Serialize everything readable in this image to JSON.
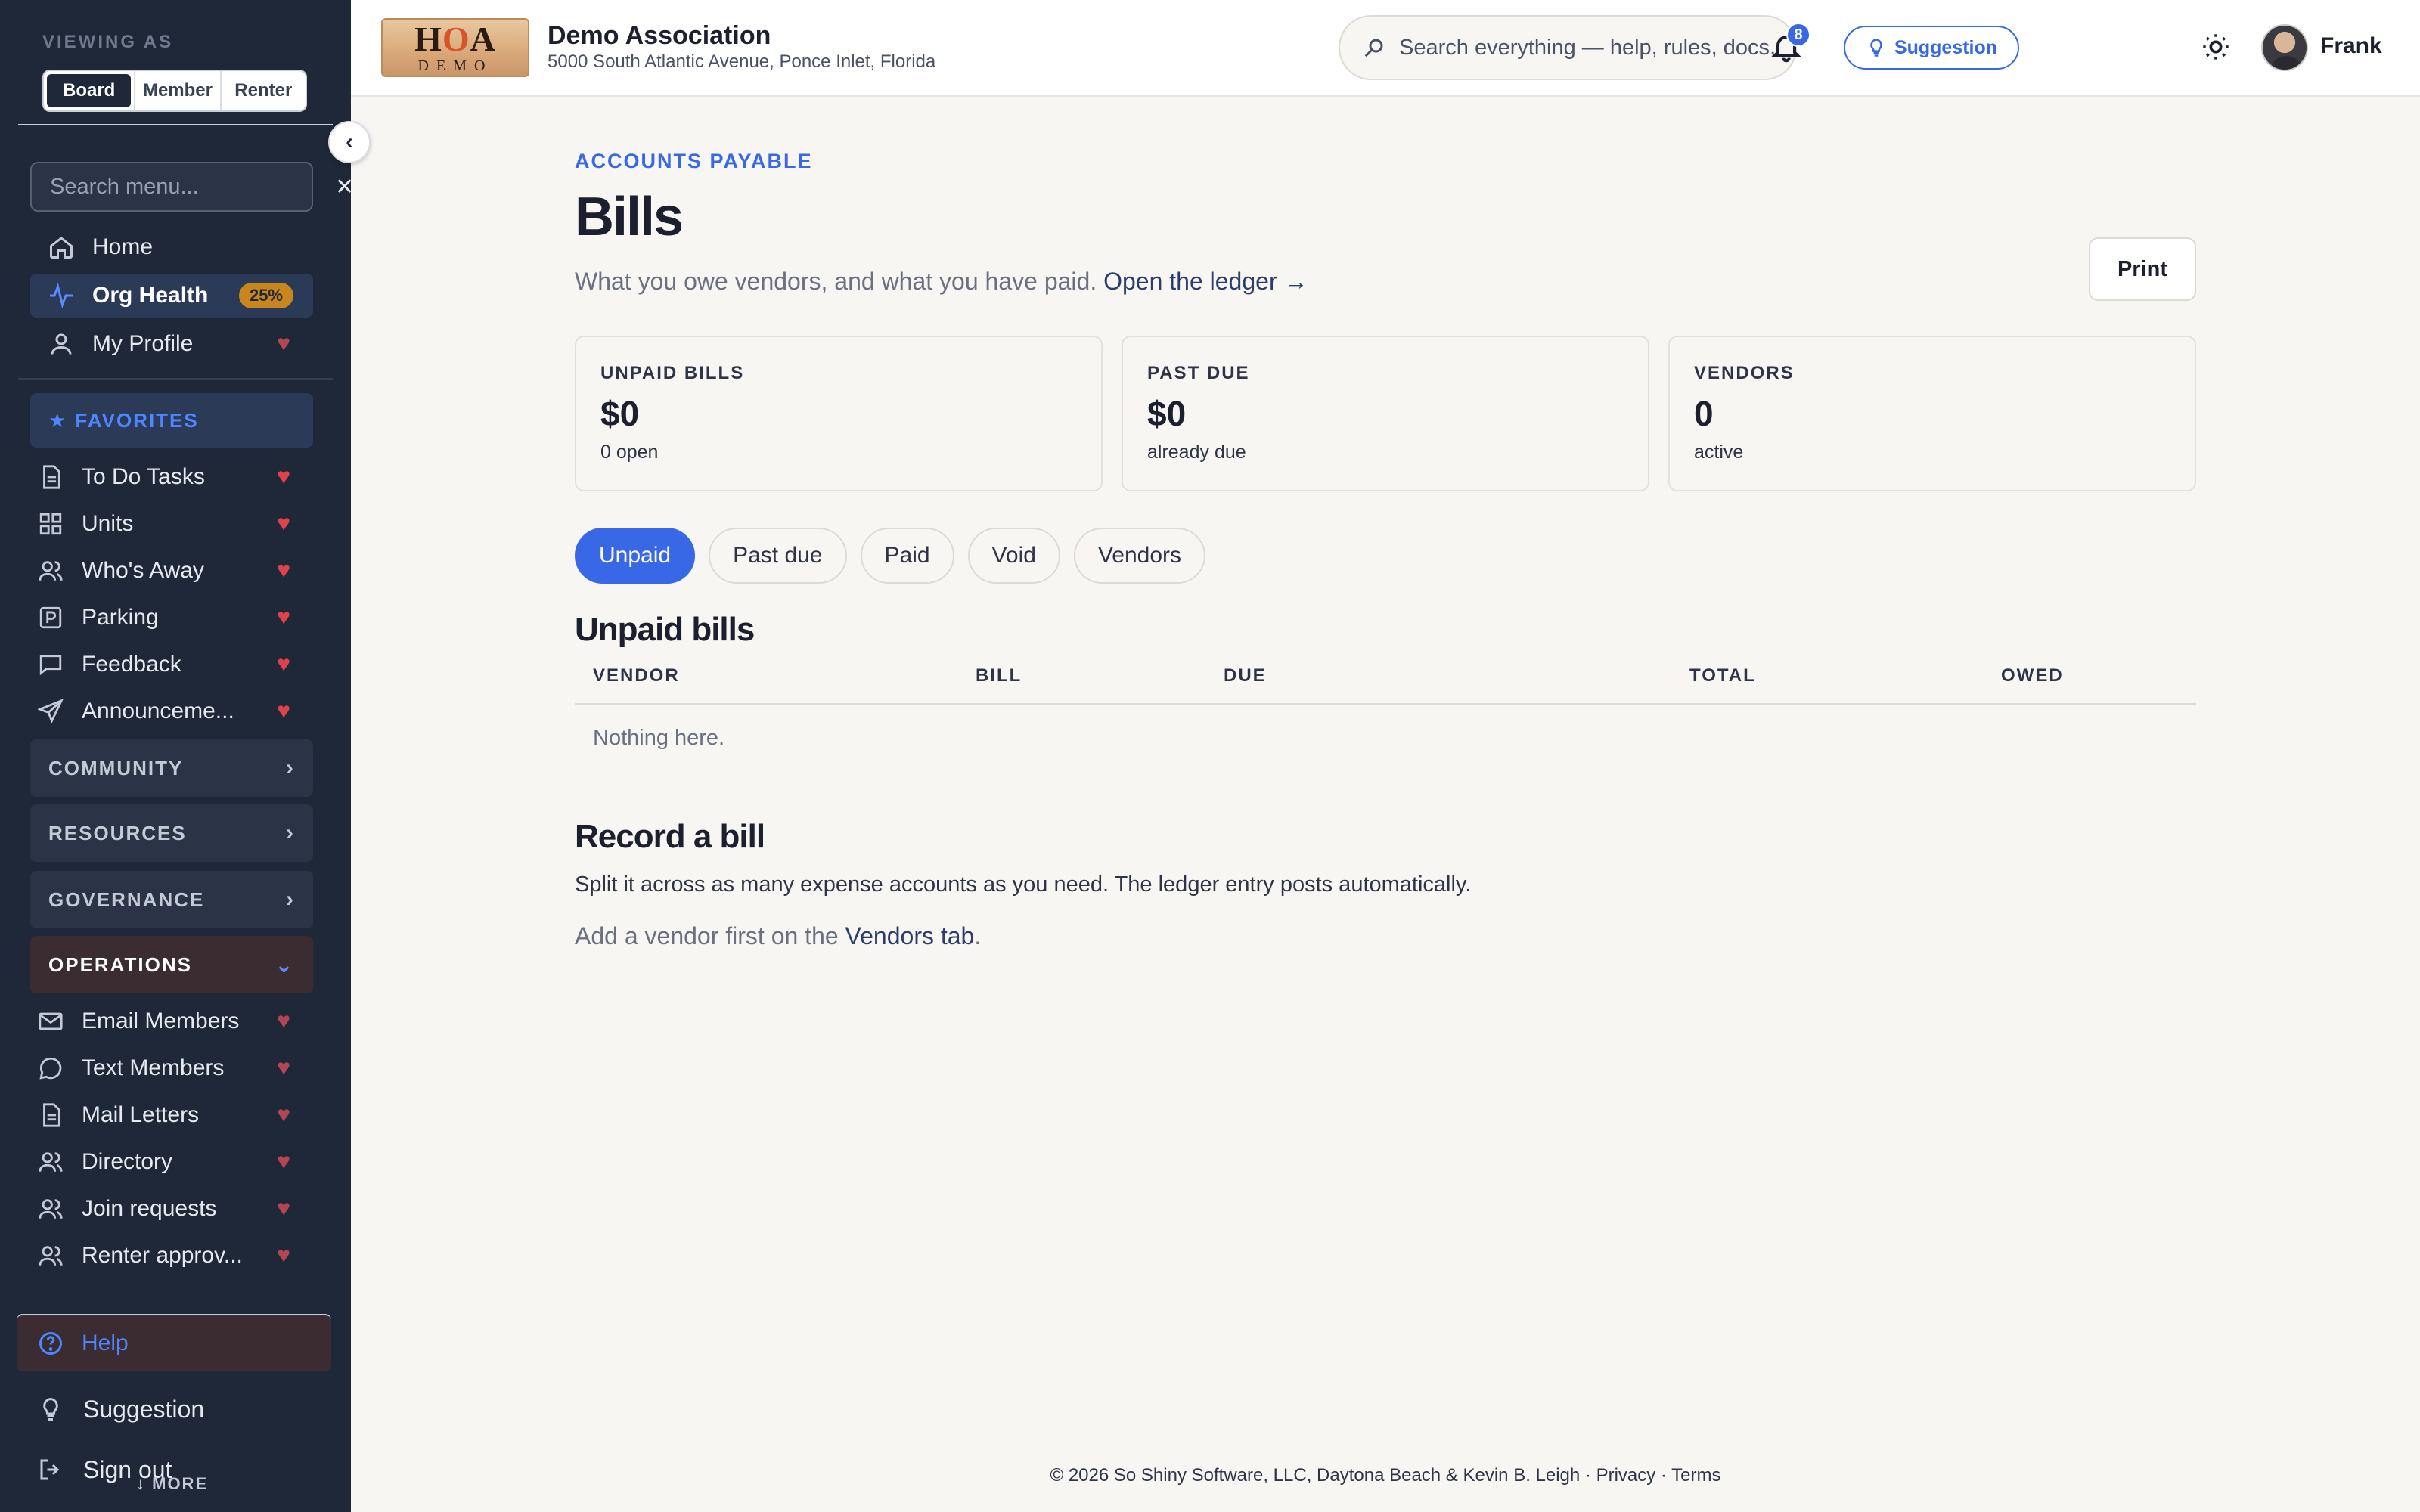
{
  "sidebar": {
    "viewing_as_label": "VIEWING AS",
    "roles": [
      "Board",
      "Member",
      "Renter"
    ],
    "search_placeholder": "Search menu...",
    "main_items": [
      {
        "label": "Home",
        "icon": "home-icon"
      },
      {
        "label": "Org Health",
        "icon": "pulse-icon",
        "badge": "25%",
        "active": true
      },
      {
        "label": "My Profile",
        "icon": "user-icon",
        "heart": true
      }
    ],
    "favorites_label": "FAVORITES",
    "favorites": [
      {
        "label": "To Do Tasks",
        "icon": "document-icon"
      },
      {
        "label": "Units",
        "icon": "grid-icon"
      },
      {
        "label": "Who's Away",
        "icon": "users-icon"
      },
      {
        "label": "Parking",
        "icon": "parking-icon"
      },
      {
        "label": "Feedback",
        "icon": "chat-icon"
      },
      {
        "label": "Announceme...",
        "icon": "send-icon"
      }
    ],
    "sections": [
      {
        "label": "COMMUNITY",
        "open": false
      },
      {
        "label": "RESOURCES",
        "open": false
      },
      {
        "label": "GOVERNANCE",
        "open": false
      },
      {
        "label": "OPERATIONS",
        "open": true
      }
    ],
    "operations_items": [
      {
        "label": "Email Members",
        "icon": "mail-icon"
      },
      {
        "label": "Text Members",
        "icon": "message-icon"
      },
      {
        "label": "Mail Letters",
        "icon": "document-icon"
      },
      {
        "label": "Directory",
        "icon": "users-icon"
      },
      {
        "label": "Join requests",
        "icon": "users-icon"
      },
      {
        "label": "Renter approv...",
        "icon": "users-icon"
      }
    ],
    "help_label": "Help",
    "suggestion_label": "Suggestion",
    "signout_label": "Sign out",
    "more_label": "↓ MORE"
  },
  "header": {
    "logo_top": "HOA",
    "logo_bottom": "DEMO",
    "org_name": "Demo Association",
    "org_address": "5000 South Atlantic Avenue, Ponce Inlet, Florida",
    "search_placeholder": "Search everything — help, rules, docs, members",
    "suggestion_label": "Suggestion",
    "notification_count": "8",
    "user_name": "Frank"
  },
  "main": {
    "eyebrow": "ACCOUNTS PAYABLE",
    "title": "Bills",
    "subtitle": "What you owe vendors, and what you have paid.",
    "ledger_link": "Open the ledger →",
    "print_label": "Print",
    "stats": [
      {
        "label": "UNPAID BILLS",
        "value": "$0",
        "sub": "0 open"
      },
      {
        "label": "PAST DUE",
        "value": "$0",
        "sub": "already due"
      },
      {
        "label": "VENDORS",
        "value": "0",
        "sub": "active"
      }
    ],
    "tabs": [
      {
        "label": "Unpaid",
        "active": true
      },
      {
        "label": "Past due",
        "active": false
      },
      {
        "label": "Paid",
        "active": false
      },
      {
        "label": "Void",
        "active": false
      },
      {
        "label": "Vendors",
        "active": false
      }
    ],
    "unpaid_title": "Unpaid bills",
    "columns": [
      "VENDOR",
      "BILL",
      "DUE",
      "TOTAL",
      "OWED"
    ],
    "empty_text": "Nothing here.",
    "record_title": "Record a bill",
    "record_desc": "Split it across as many expense accounts as you need. The ledger entry posts automatically.",
    "record_note_prefix": "Add a vendor first on the",
    "record_note_link": "Vendors tab",
    "record_note_suffix": "."
  },
  "footer": {
    "text": "© 2026 So Shiny Software, LLC, Daytona Beach & Kevin B. Leigh · Privacy · Terms"
  },
  "colors": {
    "sidebar_bg": "#1f2838",
    "accent": "#3868e6",
    "heart": "#e0424b",
    "badge": "#c8861c",
    "page_bg": "#f7f6f3"
  }
}
